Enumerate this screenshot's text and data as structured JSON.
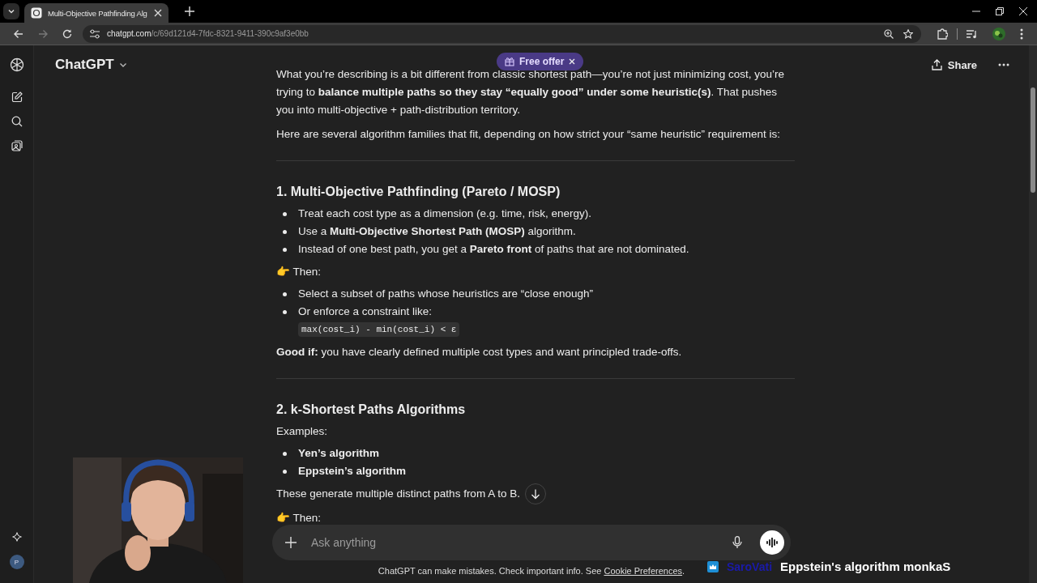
{
  "browser": {
    "tab_title": "Multi-Objective Pathfinding Alg",
    "url_host": "chatgpt.com",
    "url_path": "/c/69d121d4-7fdc-8321-9411-390c9af3e0bb"
  },
  "header": {
    "model": "ChatGPT",
    "promo": "Free offer",
    "share": "Share"
  },
  "sidebar": {
    "avatar": "P"
  },
  "message": {
    "blocks": [
      {
        "kind": "para",
        "text": "What you’re describing is a bit different from classic shortest path—you’re not just minimizing cost, you’re trying to **balance multiple paths so they stay “equally good” under some heuristic(s)**. That pushes you into multi-objective + path-distribution territory."
      },
      {
        "kind": "para",
        "text": "Here are several algorithm families that fit, depending on how strict your “same heuristic” requirement is:"
      },
      {
        "kind": "rule"
      },
      {
        "kind": "heading",
        "text": "1. Multi-Objective Pathfinding (Pareto / MOSP)"
      },
      {
        "kind": "list",
        "items": [
          {
            "text": "Treat each cost type as a dimension (e.g. time, risk, energy)."
          },
          {
            "text": "Use a **Multi-Objective Shortest Path (MOSP)** algorithm."
          },
          {
            "text": "Instead of one best path, you get a **Pareto front** of paths that are not dominated."
          }
        ]
      },
      {
        "kind": "para",
        "text": "👉 Then:"
      },
      {
        "kind": "list",
        "items": [
          {
            "text": "Select a subset of paths whose heuristics are “close enough”"
          },
          {
            "text": "Or enforce a constraint like:",
            "code": "max(cost_i) - min(cost_i) < ε"
          }
        ]
      },
      {
        "kind": "para",
        "text": "**Good if:** you have clearly defined multiple cost types and want principled trade-offs."
      },
      {
        "kind": "rule"
      },
      {
        "kind": "heading",
        "text": "2. k-Shortest Paths Algorithms"
      },
      {
        "kind": "para",
        "text": "Examples:"
      },
      {
        "kind": "list",
        "items": [
          {
            "text": "**Yen’s algorithm**"
          },
          {
            "text": "**Eppstein’s algorithm**"
          }
        ]
      },
      {
        "kind": "para",
        "text": "These generate multiple distinct paths from A to B."
      },
      {
        "kind": "para",
        "text": "👉 Then:"
      }
    ]
  },
  "composer": {
    "placeholder": "Ask anything"
  },
  "footer": {
    "text": "ChatGPT can make mistakes. Check important info. See",
    "link": "Cookie Preferences",
    "end": "."
  },
  "chat_overlay": {
    "user": "SaroVati",
    "message": "Eppstein's algorithm monkaS"
  }
}
